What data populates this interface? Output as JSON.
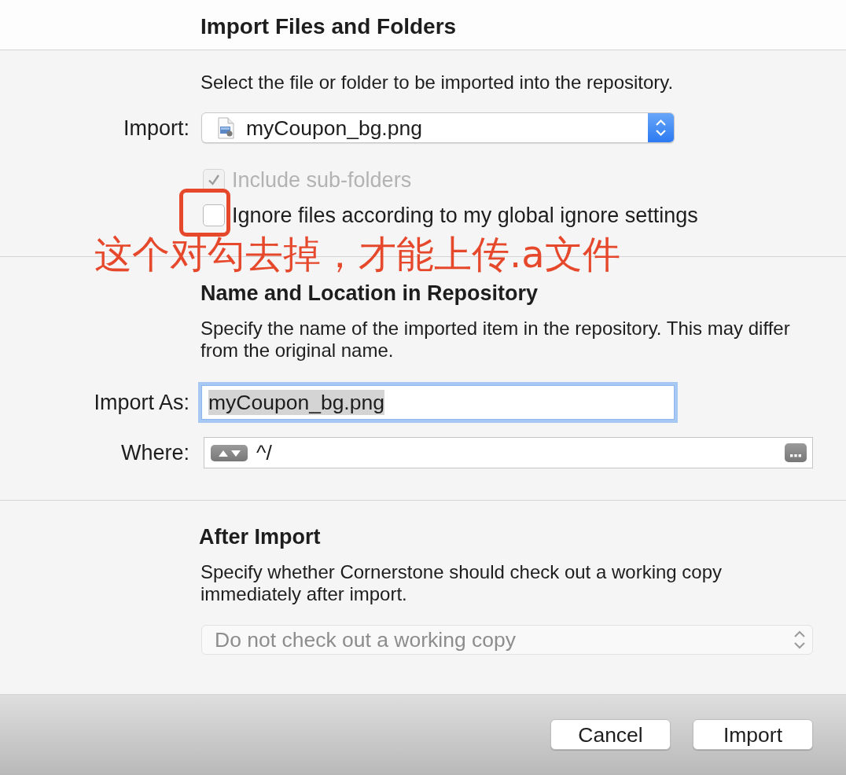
{
  "dialog": {
    "title": "Import Files and Folders"
  },
  "source_section": {
    "description": "Select the file or folder to be imported into the repository.",
    "import_label": "Import:",
    "import_popup": {
      "value": "myCoupon_bg.png"
    },
    "options": [
      {
        "label": "Include sub-folders",
        "checked": true,
        "disabled": true,
        "highlighted": false
      },
      {
        "label": "Ignore files according to my global ignore settings",
        "checked": false,
        "disabled": false,
        "highlighted": true
      }
    ]
  },
  "annotation": {
    "text": "这个对勾去掉，才能上传.a文件"
  },
  "location_section": {
    "heading": "Name and Location in Repository",
    "description": "Specify the name of the imported item in the repository. This may differ from the original name.",
    "import_as": {
      "label": "Import As:",
      "value": "myCoupon_bg.png",
      "focused": true,
      "text_selected": true
    },
    "where": {
      "label": "Where:",
      "value": "^/"
    }
  },
  "after_import_section": {
    "heading": "After Import",
    "description": "Specify whether Cornerstone should check out a working copy immediately after import.",
    "popup": {
      "value": "Do not check out a working copy",
      "disabled": true
    }
  },
  "buttons": [
    {
      "label": "Cancel"
    },
    {
      "label": "Import"
    }
  ]
}
